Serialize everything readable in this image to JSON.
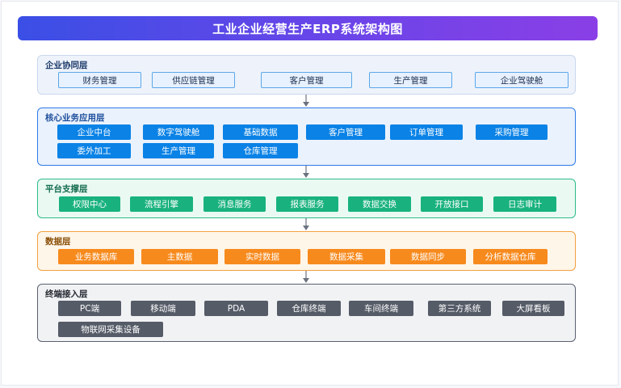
{
  "title": "工业企业经营生产ERP系统架构图",
  "colors": {
    "title_gradient": [
      "#3a4fe6",
      "#8a3fe6"
    ],
    "layer_collab": "#5aa7ea",
    "layer_core": "#0a82e6",
    "layer_platform": "#19b27f",
    "layer_data": "#f78a1d",
    "layer_terminal": "#555b67",
    "arrow": "#6b7280"
  },
  "layers": [
    {
      "name": "企业协同层",
      "items": [
        "财务管理",
        "供应链管理",
        "客户管理",
        "生产管理",
        "企业驾驶舱"
      ]
    },
    {
      "name": "核心业务应用层",
      "items": [
        "企业中台",
        "数字驾驶舱",
        "基础数据",
        "客户管理",
        "订单管理",
        "采购管理",
        "委外加工",
        "生产管理",
        "仓库管理"
      ]
    },
    {
      "name": "平台支撑层",
      "items": [
        "权限中心",
        "流程引擎",
        "消息服务",
        "报表服务",
        "数据交换",
        "开放接口",
        "日志审计"
      ]
    },
    {
      "name": "数据层",
      "items": [
        "业务数据库",
        "主数据",
        "实时数据",
        "数据采集",
        "数据同步",
        "分析数据仓库"
      ]
    },
    {
      "name": "终端接入层",
      "items": [
        "PC端",
        "移动端",
        "PDA",
        "仓库终端",
        "车间终端",
        "第三方系统",
        "大屏看板",
        "物联网采集设备"
      ]
    }
  ]
}
